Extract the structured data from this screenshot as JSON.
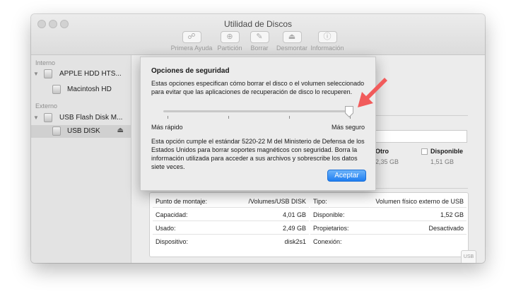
{
  "window": {
    "title": "Utilidad de Discos"
  },
  "toolbar": {
    "items": [
      {
        "label": "Primera Ayuda",
        "icon": "stethoscope-icon",
        "glyph": "☍"
      },
      {
        "label": "Partición",
        "icon": "partition-icon",
        "glyph": "⊕"
      },
      {
        "label": "Borrar",
        "icon": "erase-icon",
        "glyph": "✎"
      },
      {
        "label": "Desmontar",
        "icon": "unmount-icon",
        "glyph": "⏏"
      },
      {
        "label": "Información",
        "icon": "info-icon",
        "glyph": "ⓘ"
      }
    ]
  },
  "sidebar": {
    "internal_heading": "Interno",
    "external_heading": "Externo",
    "items": [
      {
        "label": "APPLE HDD HTS...",
        "level": 0
      },
      {
        "label": "Macintosh HD",
        "level": 1
      },
      {
        "label": "USB Flash Disk M...",
        "level": 0
      },
      {
        "label": "USB DISK",
        "level": 1,
        "selected": true
      }
    ],
    "eject_glyph": "⏏"
  },
  "legend": {
    "other_label": "Otro",
    "other_value": "2,35 GB",
    "available_label": "Disponible",
    "available_value": "1,51 GB"
  },
  "info": {
    "left": [
      {
        "key": "Punto de montaje:",
        "value": "/Volumes/USB DISK"
      },
      {
        "key": "Capacidad:",
        "value": "4,01 GB"
      },
      {
        "key": "Usado:",
        "value": "2,49 GB"
      },
      {
        "key": "Dispositivo:",
        "value": "disk2s1"
      }
    ],
    "right": [
      {
        "key": "Tipo:",
        "value": "Volumen físico externo de USB"
      },
      {
        "key": "Disponible:",
        "value": "1,52 GB"
      },
      {
        "key": "Propietarios:",
        "value": "Desactivado"
      },
      {
        "key": "Conexión:",
        "value": ""
      }
    ],
    "usb_badge": "USB"
  },
  "dialog": {
    "title": "Opciones de seguridad",
    "description": "Estas opciones especifican cómo borrar el disco o el volumen seleccionado para evitar que las aplicaciones de recuperación de disco lo recuperen.",
    "slider": {
      "min_label": "Más rápido",
      "max_label": "Más seguro",
      "value_fraction": 1.0,
      "ticks": 4
    },
    "detail": "Esta opción cumple el estándar 5220-22 M del Ministerio de Defensa de los Estados Unidos para borrar soportes magnéticos con seguridad. Borra la información utilizada para acceder a sus archivos y sobrescribe los datos siete veces.",
    "accept_label": "Aceptar"
  },
  "colors": {
    "accent": "#1f7ef1",
    "annotation_arrow": "#f15b5b"
  }
}
